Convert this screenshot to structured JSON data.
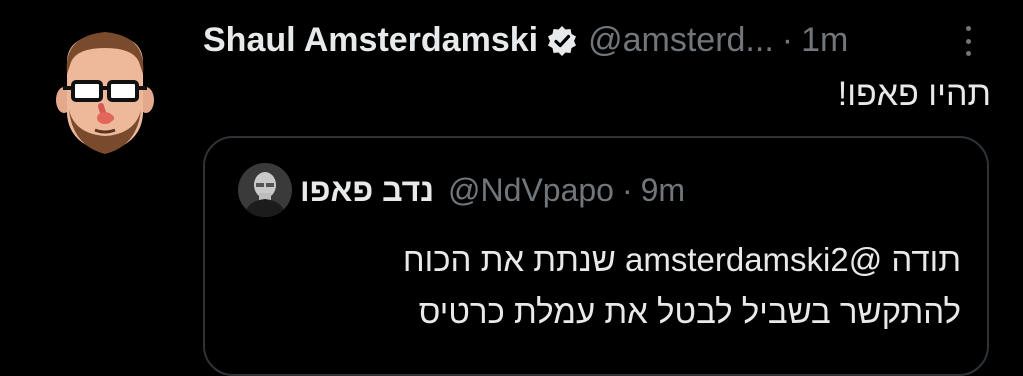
{
  "tweet": {
    "author_name": "Shaul Amsterdamski",
    "author_handle": "@amsterd...",
    "separator": "·",
    "timestamp": "1m",
    "body": "תהיו פאפו!",
    "more_icon": "more-vertical-icon",
    "verified_icon": "verified-badge-icon"
  },
  "quoted_tweet": {
    "author_name": "נדב פאפו",
    "author_handle": "@NdVpapo",
    "separator": "·",
    "timestamp": "9m",
    "lines": [
      "תודה @amsterdamski2 שנתת את הכוח",
      "להתקשר בשביל לבטל את עמלת כרטיס"
    ]
  },
  "colors": {
    "background": "#000000",
    "primary_text": "#e7e9ea",
    "secondary_text": "#71767b",
    "border": "#2f3336"
  }
}
